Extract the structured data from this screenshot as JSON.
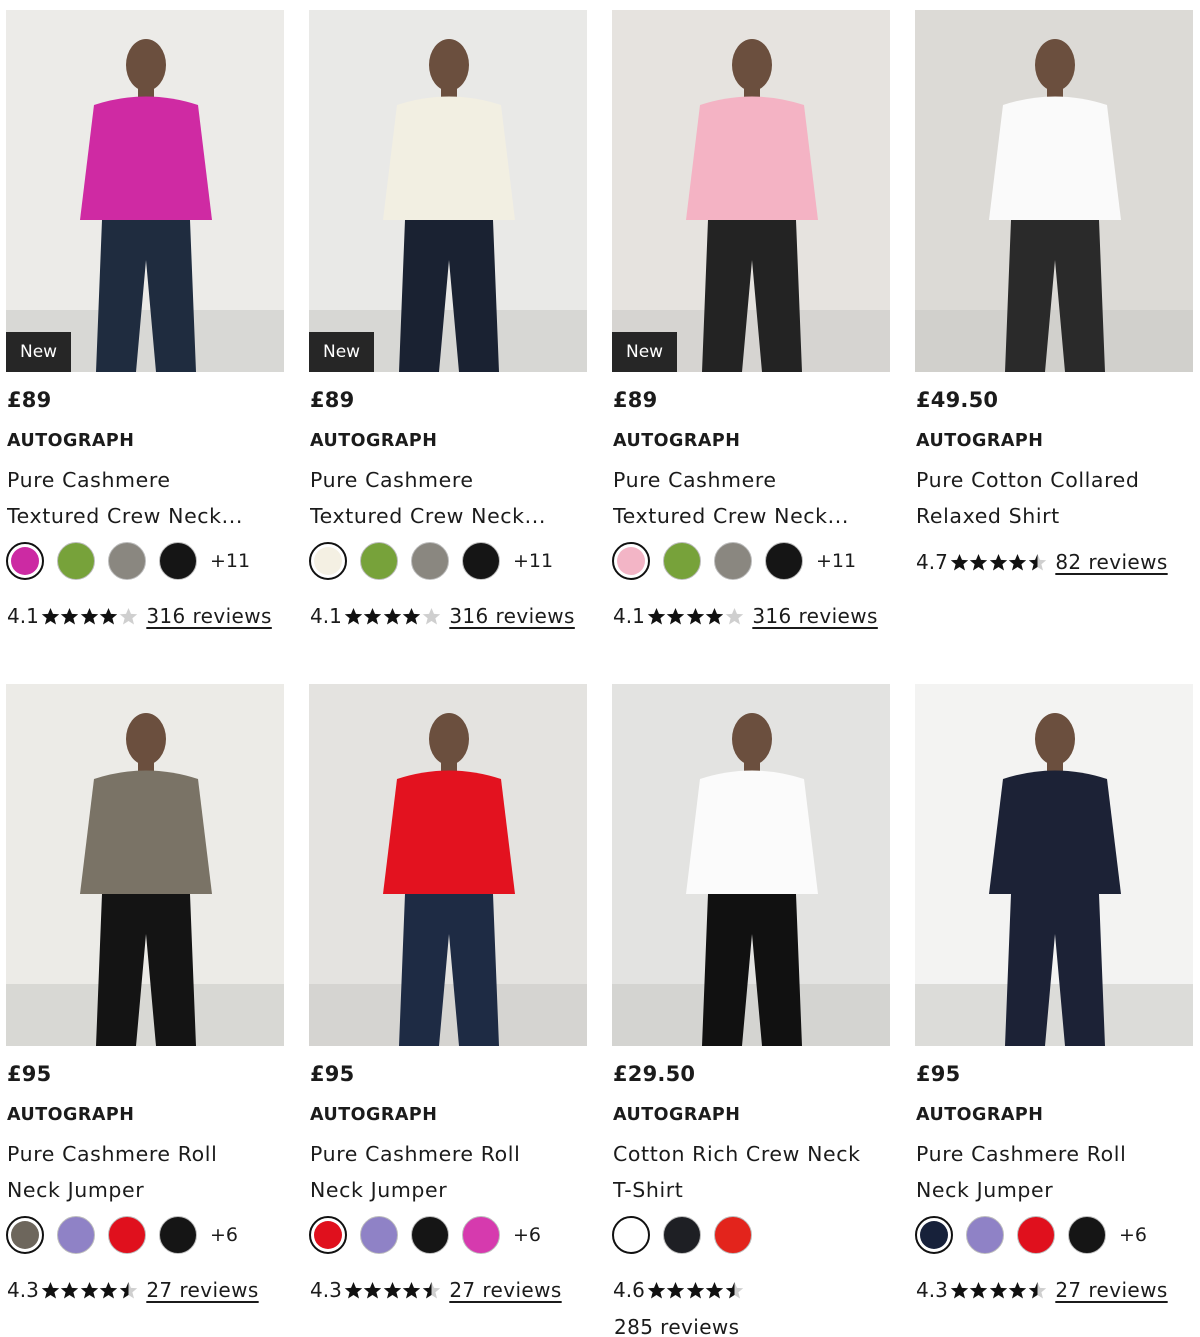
{
  "products": [
    {
      "price": "£89",
      "brand": "AUTOGRAPH",
      "name_line1": "Pure Cashmere",
      "name_line2": "Textured Crew Neck...",
      "badge": "New",
      "swatches": [
        "#cc2aa3",
        "#77a23a",
        "#8a8780",
        "#151515"
      ],
      "more_colours": "+11",
      "rating": "4.1",
      "stars": 4.1,
      "reviews": "316 reviews",
      "photo_top": "#cf2aa3",
      "photo_bottom": "#1f2c3f",
      "photo_bg": "#ecebe8"
    },
    {
      "price": "£89",
      "brand": "AUTOGRAPH",
      "name_line1": "Pure Cashmere",
      "name_line2": "Textured Crew Neck...",
      "badge": "New",
      "swatches": [
        "#f4f0e3",
        "#77a23a",
        "#8a8780",
        "#151515"
      ],
      "more_colours": "+11",
      "rating": "4.1",
      "stars": 4.1,
      "reviews": "316 reviews",
      "photo_top": "#f2efe2",
      "photo_bottom": "#1a2232",
      "photo_bg": "#e9e9e7"
    },
    {
      "price": "£89",
      "brand": "AUTOGRAPH",
      "name_line1": "Pure Cashmere",
      "name_line2": "Textured Crew Neck...",
      "badge": "New",
      "swatches": [
        "#f3b5c6",
        "#77a23a",
        "#8a8780",
        "#151515"
      ],
      "more_colours": "+11",
      "rating": "4.1",
      "stars": 4.1,
      "reviews": "316 reviews",
      "photo_top": "#f4b3c4",
      "photo_bottom": "#232323",
      "photo_bg": "#e6e3df"
    },
    {
      "price": "£49.50",
      "brand": "AUTOGRAPH",
      "name_line1": "Pure Cotton Collared",
      "name_line2": "Relaxed Shirt",
      "badge": "",
      "swatches": [],
      "more_colours": "",
      "rating": "4.7",
      "stars": 4.7,
      "reviews": "82 reviews",
      "photo_top": "#fafafa",
      "photo_bottom": "#2a2a2a",
      "photo_bg": "#dcdad6"
    },
    {
      "price": "£95",
      "brand": "AUTOGRAPH",
      "name_line1": "Pure Cashmere Roll",
      "name_line2": "Neck Jumper",
      "badge": "",
      "swatches": [
        "#6d665c",
        "#8f82c6",
        "#e0101d",
        "#151515"
      ],
      "more_colours": "+6",
      "rating": "4.3",
      "stars": 4.3,
      "reviews": "27 reviews",
      "photo_top": "#7a7366",
      "photo_bottom": "#141414",
      "photo_bg": "#ecebe7"
    },
    {
      "price": "£95",
      "brand": "AUTOGRAPH",
      "name_line1": "Pure Cashmere Roll",
      "name_line2": "Neck Jumper",
      "badge": "",
      "swatches": [
        "#e0101d",
        "#8f82c6",
        "#151515",
        "#d63aae"
      ],
      "more_colours": "+6",
      "rating": "4.3",
      "stars": 4.3,
      "reviews": "27 reviews",
      "photo_top": "#e3121f",
      "photo_bottom": "#1e2b44",
      "photo_bg": "#e4e3e0"
    },
    {
      "price": "£29.50",
      "brand": "AUTOGRAPH",
      "name_line1": "Cotton Rich Crew Neck",
      "name_line2": "T-Shirt",
      "badge": "",
      "swatches": [
        "#ffffff",
        "#1e1f24",
        "#e3241c"
      ],
      "more_colours": "",
      "rating": "4.6",
      "stars": 4.6,
      "reviews": "285 reviews",
      "photo_top": "#fbfbfb",
      "photo_bottom": "#111111",
      "photo_bg": "#e3e3e1"
    },
    {
      "price": "£95",
      "brand": "AUTOGRAPH",
      "name_line1": "Pure Cashmere Roll",
      "name_line2": "Neck Jumper",
      "badge": "",
      "swatches": [
        "#17213a",
        "#8f82c6",
        "#e0101d",
        "#151515"
      ],
      "more_colours": "+6",
      "rating": "4.3",
      "stars": 4.3,
      "reviews": "27 reviews",
      "photo_top": "#1c2236",
      "photo_bottom": "#1c2236",
      "photo_bg": "#f3f3f2"
    }
  ]
}
